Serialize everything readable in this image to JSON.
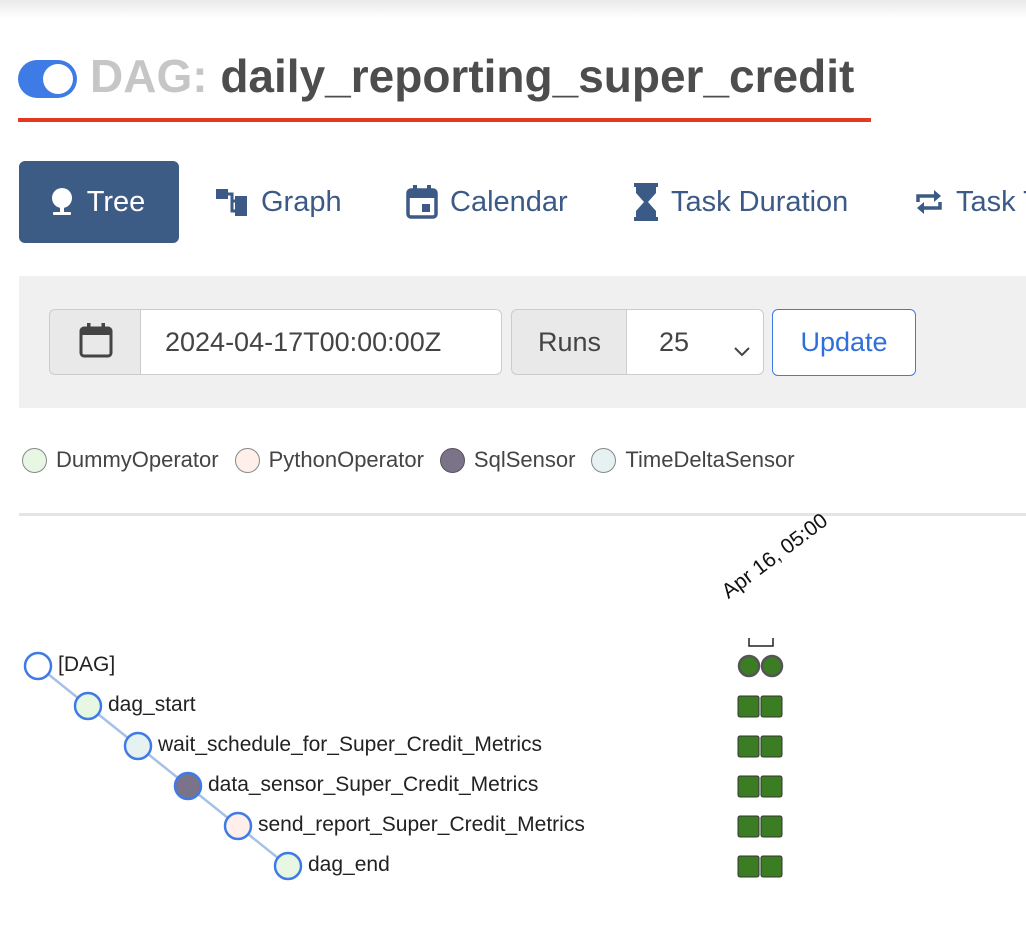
{
  "header": {
    "title_prefix": "DAG:",
    "dag_name": "daily_reporting_super_credit",
    "paused_toggle_on": true
  },
  "tabs": [
    {
      "label": "Tree",
      "icon": "tree-icon",
      "active": true
    },
    {
      "label": "Graph",
      "icon": "graph-icon",
      "active": false
    },
    {
      "label": "Calendar",
      "icon": "calendar-icon",
      "active": false
    },
    {
      "label": "Task Duration",
      "icon": "hourglass-icon",
      "active": false
    },
    {
      "label": "Task T",
      "icon": "retry-icon",
      "active": false
    }
  ],
  "toolbar": {
    "base_date": "2024-04-17T00:00:00Z",
    "runs_label": "Runs",
    "runs_value": "25",
    "update_label": "Update"
  },
  "legend": [
    {
      "label": "DummyOperator",
      "color": "#e8f7e4"
    },
    {
      "label": "PythonOperator",
      "color": "#ffefeb"
    },
    {
      "label": "SqlSensor",
      "color": "#7a7389"
    },
    {
      "label": "TimeDeltaSensor",
      "color": "#e6f1f2"
    }
  ],
  "tree": {
    "run_header": "Apr 16, 05:00",
    "nodes": [
      {
        "label": "[DAG]",
        "color": "#ffffff"
      },
      {
        "label": "dag_start",
        "color": "#e8f7e4"
      },
      {
        "label": "wait_schedule_for_Super_Credit_Metrics",
        "color": "#e6f1f2"
      },
      {
        "label": "data_sensor_Super_Credit_Metrics",
        "color": "#7a7389"
      },
      {
        "label": "send_report_Super_Credit_Metrics",
        "color": "#ffefeb"
      },
      {
        "label": "dag_end",
        "color": "#e8f7e4"
      }
    ],
    "status_color": "#3b7d23",
    "runs_per_row": 2
  }
}
